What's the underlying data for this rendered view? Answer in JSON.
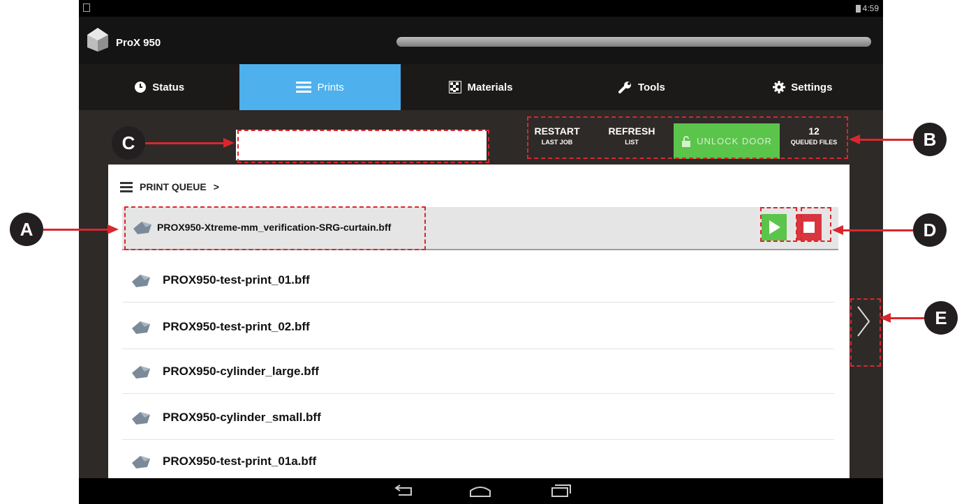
{
  "status_bar": {
    "time": "4:59"
  },
  "header": {
    "app_title": "ProX 950"
  },
  "tabs": [
    {
      "label": "Status",
      "icon": "clock-icon"
    },
    {
      "label": "Prints",
      "icon": "list-icon",
      "active": true
    },
    {
      "label": "Materials",
      "icon": "materials-icon"
    },
    {
      "label": "Tools",
      "icon": "wrench-icon"
    },
    {
      "label": "Settings",
      "icon": "gear-icon"
    }
  ],
  "toolbar": {
    "restart": {
      "line1": "RESTART",
      "line2": "LAST JOB"
    },
    "refresh": {
      "line1": "REFRESH",
      "line2": "LIST"
    },
    "unlock_label": "UNLOCK DOOR",
    "queued": {
      "count": "12",
      "label": "QUEUED FILES"
    }
  },
  "queue": {
    "header": "PRINT QUEUE",
    "selected_file": "PROX950-Xtreme-mm_verification-SRG-curtain.bff",
    "files": [
      "PROX950-test-print_01.bff",
      "PROX950-test-print_02.bff",
      "PROX950-cylinder_large.bff",
      "PROX950-cylinder_small.bff",
      "PROX950-test-print_01a.bff"
    ]
  },
  "callouts": {
    "a": "A",
    "b": "B",
    "c": "C",
    "d": "D",
    "e": "E"
  },
  "colors": {
    "accent_blue": "#4eb0ec",
    "green": "#5bc44b",
    "red": "#d8353f",
    "annotation_red": "#d9272e"
  }
}
